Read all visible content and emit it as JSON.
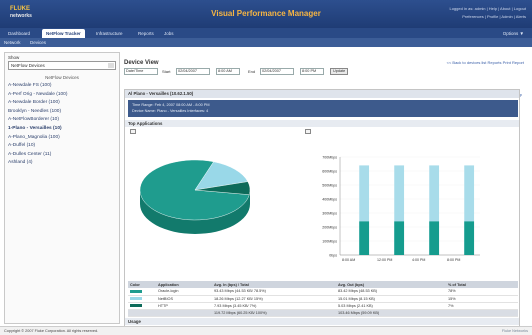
{
  "header": {
    "logo_line1": "FLUKE",
    "logo_line2": "networks",
    "app_title": "Visual Performance Manager",
    "top_links": "Logged in as: admin  |  Help  |  About  |  Logout",
    "top_links2": "Preferences  |  Profile  |  Admin  |  Alerts"
  },
  "tabs": [
    {
      "label": "Dashboard"
    },
    {
      "label": "NetFlow Tracker"
    },
    {
      "label": "Infrastructure"
    },
    {
      "label": "Reports"
    },
    {
      "label": "Jobs"
    }
  ],
  "tabbar_right": "Options ▼",
  "subbar": {
    "item1": "Network",
    "item2": "Devices"
  },
  "sidebar": {
    "label": "Show",
    "select_value": "NetFlow Devices",
    "list_header": "NetFlow Devices",
    "items": [
      "A-Newdale FS (100)",
      "A-Perf Orig - Newdale (100)",
      "A-Newdale Border (100)",
      "Brooklyn - Needles (100)",
      "A-NetFlowBorderer (10)",
      "1-Plano - Versailles (10)",
      "A-Plano_Magnolia (100)",
      "A-Duffel (10)",
      "A-Dulles Center (11)",
      "Ashland (4)"
    ],
    "selected_index": 5
  },
  "main": {
    "title": "Device View",
    "links": "<< Back to devices list    Reports   Print Report",
    "ctrl": {
      "range": "Date/Time",
      "start_label": "Start",
      "start_date": "02/04/2007",
      "start_time": "8:00 AM",
      "end_label": "End",
      "end_date": "02/04/2007",
      "end_time": "8:00 PM",
      "update_label": "Update"
    },
    "help_link": "Help",
    "panel_title": "Al Plano - Versailles (10.62.1.50)",
    "info_line1": "Time Range:     Feb 4, 2007 08:00 AM - 8:00 PM",
    "info_line2": "Device Name:    Plano - Versailles   Interfaces: 4",
    "top_apps_label": "Top Applications",
    "usage_label": "Usage"
  },
  "chart_data": [
    {
      "type": "pie",
      "slices": [
        {
          "name": "Oracle-login",
          "value": 78,
          "color": "#1f9c8e"
        },
        {
          "name": "NetBIOS",
          "value": 15,
          "color": "#99d8e8"
        },
        {
          "name": "HTTP",
          "value": 7,
          "color": "#0d6b5a"
        }
      ]
    },
    {
      "type": "bar",
      "categories": [
        "8:00 AM",
        "12:00 PM",
        "4:00 PM",
        "8:00 PM"
      ],
      "yticks": [
        "700Mbps",
        "600Mbps",
        "500Mbps",
        "400Mbps",
        "300Mbps",
        "200Mbps",
        "100Mbps",
        "0bps"
      ],
      "ylim": [
        0,
        700
      ],
      "series": [
        {
          "name": "Oracle-login",
          "values": [
            240,
            240,
            240,
            240
          ],
          "color": "#159c8e"
        },
        {
          "name": "NetBIOS",
          "values": [
            640,
            640,
            640,
            640
          ],
          "color": "#a8dcea"
        }
      ]
    }
  ],
  "table": {
    "headers": [
      "Color",
      "Application",
      "Avg. In (bps) / Total",
      "",
      "Avg. Out (bps)",
      "% of Total"
    ],
    "rows": [
      {
        "color": "#1f9c8e",
        "app": "Oracle-login",
        "in": "93.43 Mbps (44.53 KB/ 78.5%)",
        "out": "83.42 Mbps (48.53 KB)",
        "pct": "78%"
      },
      {
        "color": "#99d8e8",
        "app": "NetBIOS",
        "in": "18.26 Mbps (12.27 KB/ 15%)",
        "out": "15.01 Mbps (8.15 KB)",
        "pct": "15%"
      },
      {
        "color": "#0d6b5a",
        "app": "HTTP",
        "in": "7.93 Mbps (3.45 KB/ 7%)",
        "out": "5.03 Mbps (2.41 KB)",
        "pct": "7%"
      }
    ],
    "total": {
      "in": "119.72 Mbps (60.25 KB/ 100%)",
      "out": "103.46 Mbps (59.09 KB)"
    }
  },
  "footer": {
    "text": "Copyright © 2007 Fluke Corporation. All rights reserved.",
    "right": "Fluke Networks"
  }
}
